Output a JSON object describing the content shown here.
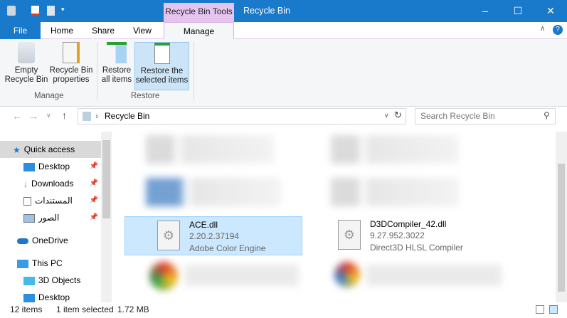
{
  "window": {
    "title": "Recycle Bin",
    "context_tab": "Recycle Bin Tools",
    "minimize": "–",
    "maximize": "☐",
    "close": "✕"
  },
  "tabs": [
    "File",
    "Home",
    "Share",
    "View",
    "Manage"
  ],
  "ribbon": {
    "manage_group": "Manage",
    "restore_group": "Restore",
    "empty": [
      "Empty",
      "Recycle Bin"
    ],
    "properties": [
      "Recycle Bin",
      "properties"
    ],
    "restore_all": [
      "Restore",
      "all items"
    ],
    "restore_selected": [
      "Restore the",
      "selected items"
    ]
  },
  "address": {
    "path": "Recycle Bin",
    "search_placeholder": "Search Recycle Bin"
  },
  "nav": [
    "Quick access",
    "Desktop",
    "Downloads",
    "المستندات",
    "الصور",
    "OneDrive",
    "This PC",
    "3D Objects",
    "Desktop"
  ],
  "files": [
    {
      "name": "ACE.dll",
      "version": "2.20.2.37194",
      "desc": "Adobe Color Engine"
    },
    {
      "name": "D3DCompiler_42.dll",
      "version": "9.27.952.3022",
      "desc": "Direct3D HLSL Compiler"
    }
  ],
  "status": {
    "count": "12 items",
    "selected": "1 item selected",
    "size": "1.72 MB"
  },
  "colors": {
    "titlebar": "#1979ca",
    "context": "#e5c5f0",
    "selection": "#cce8ff"
  }
}
